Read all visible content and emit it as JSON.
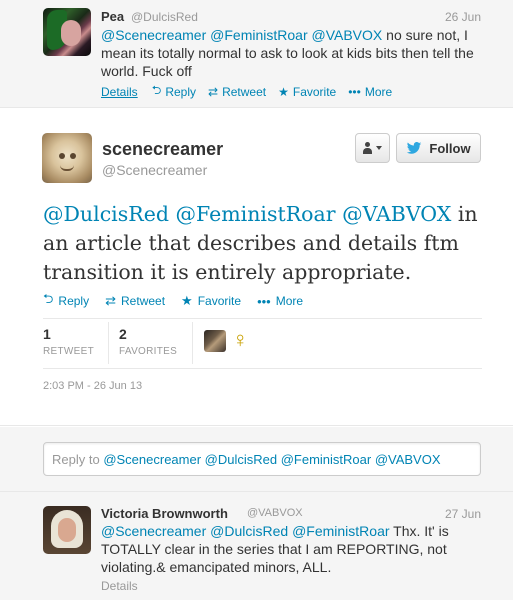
{
  "top_tweet": {
    "name": "Pea",
    "handle": "@DulcisRed",
    "date": "26 Jun",
    "mentions": [
      "@Scenecreamer",
      "@FeministRoar",
      "@VABVOX"
    ],
    "text": " no sure not, I mean its totally normal to ask to look at kids bits then tell the world. Fuck off",
    "actions": {
      "details": "Details",
      "reply": "Reply",
      "retweet": "Retweet",
      "favorite": "Favorite",
      "more": "More"
    }
  },
  "main_tweet": {
    "name": "scenecreamer",
    "handle": "@Scenecreamer",
    "follow_label": "Follow",
    "mentions": [
      "@DulcisRed",
      "@FeministRoar",
      "@VABVOX"
    ],
    "text": " in an article that describes and details ftm transition it is entirely appropriate.",
    "actions": {
      "reply": "Reply",
      "retweet": "Retweet",
      "favorite": "Favorite",
      "more": "More"
    },
    "stats": {
      "retweets": "1",
      "retweets_label": "RETWEET",
      "favorites": "2",
      "favorites_label": "FAVORITES"
    },
    "favoriter_symbol": "♀",
    "timestamp": "2:03 PM - 26 Jun 13"
  },
  "reply_box": {
    "prefix": "Reply to ",
    "mentions_text": "@Scenecreamer @DulcisRed @FeministRoar @VABVOX"
  },
  "bottom_tweet": {
    "name": "Victoria Brownworth",
    "handle": "@VABVOX",
    "date": "27 Jun",
    "mentions": [
      "@Scenecreamer",
      "@DulcisRed",
      "@FeministRoar"
    ],
    "text": " Thx. It' is TOTALLY clear in the series that I am REPORTING, not violating.& emancipated minors, ALL.",
    "details": "Details"
  },
  "colors": {
    "link": "#0084b4",
    "muted": "#999999",
    "text": "#333333",
    "panel_bg": "#f5f5f5"
  },
  "icons": [
    "reply-icon",
    "retweet-icon",
    "favorite-star-icon",
    "more-dots-icon",
    "user-icon",
    "twitter-bird-icon",
    "venus-symbol"
  ]
}
